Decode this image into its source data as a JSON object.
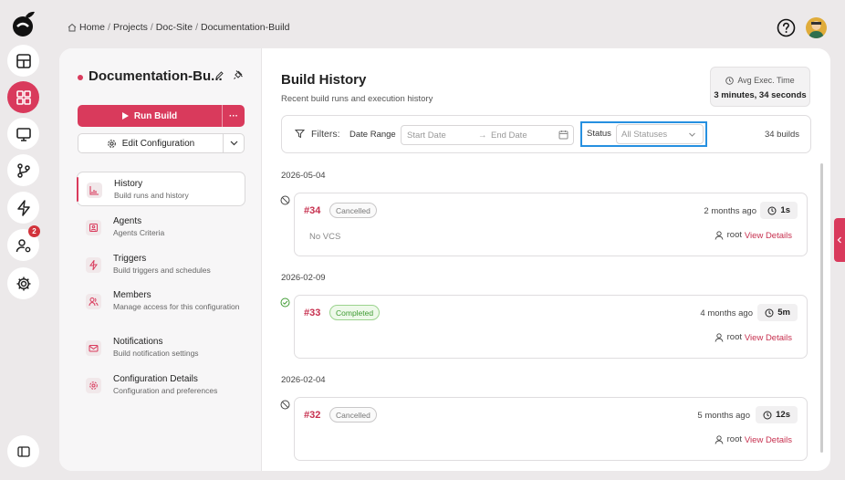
{
  "breadcrumb": {
    "home": "Home",
    "projects": "Projects",
    "site": "Doc-Site",
    "current": "Documentation-Build",
    "separator": "/"
  },
  "rail": {
    "items": [
      "layout-icon",
      "dashboard-icon",
      "monitor-icon",
      "branch-icon",
      "lightning-icon",
      "users-settings-icon",
      "gear-icon"
    ],
    "notification_count": "2"
  },
  "project": {
    "title": "Documentation-Bu..."
  },
  "actions": {
    "run_label": "Run Build",
    "more": "···",
    "edit_label": "Edit Configuration"
  },
  "nav": [
    {
      "title": "History",
      "subtitle": "Build runs and history"
    },
    {
      "title": "Agents",
      "subtitle": "Agents Criteria"
    },
    {
      "title": "Triggers",
      "subtitle": "Build triggers and schedules"
    },
    {
      "title": "Members",
      "subtitle": "Manage access for this configuration"
    },
    {
      "title": "Notifications",
      "subtitle": "Build notification settings"
    },
    {
      "title": "Configuration Details",
      "subtitle": "Configuration and preferences"
    }
  ],
  "history": {
    "title": "Build History",
    "subtitle": "Recent build runs and execution history"
  },
  "avg": {
    "label": "Avg Exec. Time",
    "value": "3 minutes, 34 seconds"
  },
  "filters": {
    "label": "Filters:",
    "date_range": "Date Range",
    "start_placeholder": "Start Date",
    "arrow": "→",
    "end_placeholder": "End Date",
    "status_label": "Status",
    "status_value": "All Statuses",
    "count": "34 builds"
  },
  "runs": [
    {
      "date": "2026-05-04",
      "number": "#34",
      "status": "Cancelled",
      "ago": "2 months ago",
      "duration": "1s",
      "vcs": "No VCS",
      "user": "root",
      "details": "View Details"
    },
    {
      "date": "2026-02-09",
      "number": "#33",
      "status": "Completed",
      "ago": "4 months ago",
      "duration": "5m",
      "vcs": "",
      "user": "root",
      "details": "View Details"
    },
    {
      "date": "2026-02-04",
      "number": "#32",
      "status": "Cancelled",
      "ago": "5 months ago",
      "duration": "12s",
      "vcs": "",
      "user": "root",
      "details": "View Details"
    }
  ],
  "colors": {
    "accent": "#d93a5c",
    "focus": "#2690e0",
    "success": "#3f9b32"
  }
}
